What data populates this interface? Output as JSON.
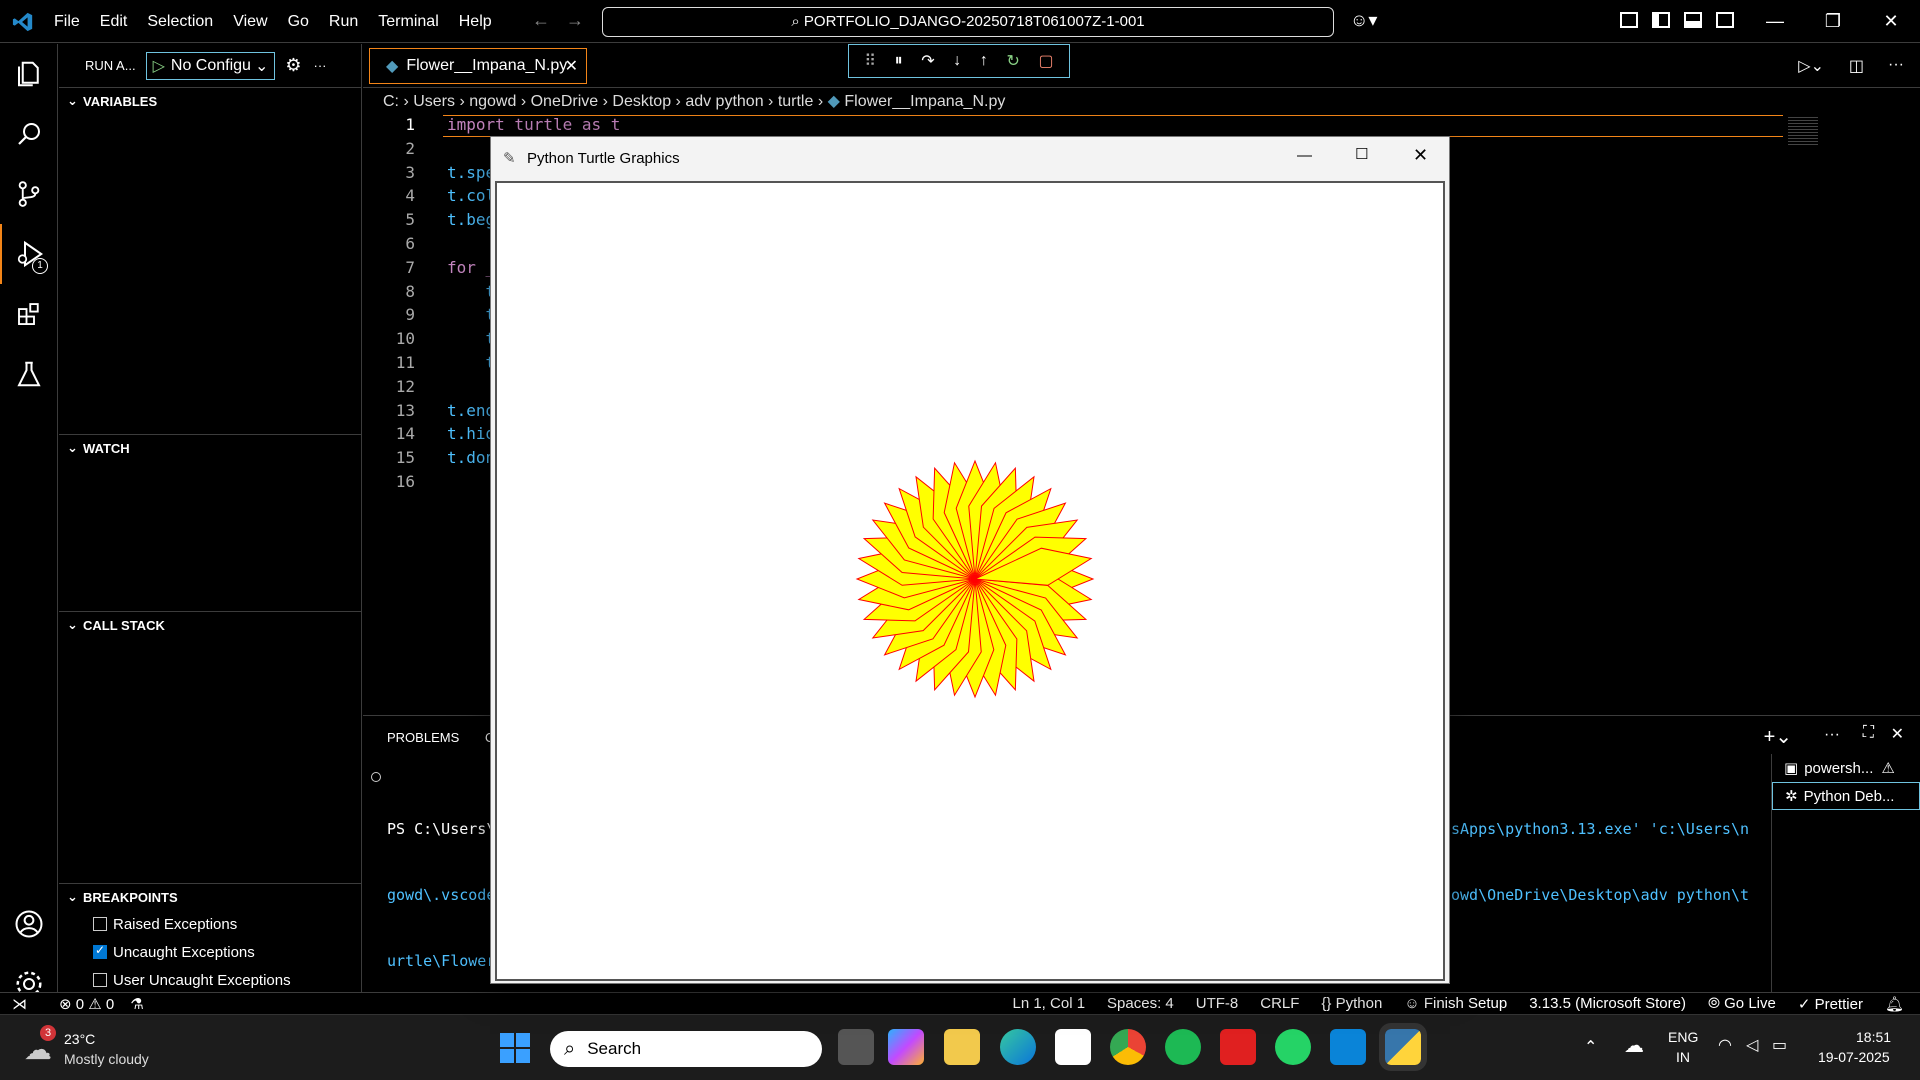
{
  "titlebar": {
    "menu": [
      "File",
      "Edit",
      "Selection",
      "View",
      "Go",
      "Run",
      "Terminal",
      "Help"
    ],
    "command_center": "PORTFOLIO_DJANGO-20250718T061007Z-1-001"
  },
  "sidebar": {
    "run_label": "RUN A...",
    "config": "No Configu",
    "sections": {
      "variables": "VARIABLES",
      "watch": "WATCH",
      "call_stack": "CALL STACK",
      "breakpoints": "BREAKPOINTS"
    },
    "breakpoints": [
      {
        "label": "Raised Exceptions",
        "checked": false
      },
      {
        "label": "Uncaught Exceptions",
        "checked": true
      },
      {
        "label": "User Uncaught Exceptions",
        "checked": false
      }
    ]
  },
  "activity": {
    "debug_badge": "1"
  },
  "editor": {
    "tab": "Flower__Impana_N.py",
    "breadcrumb": [
      "C:",
      "Users",
      "ngowd",
      "OneDrive",
      "Desktop",
      "adv python",
      "turtle",
      "Flower__Impana_N.py"
    ],
    "line_numbers": [
      "1",
      "2",
      "3",
      "4",
      "5",
      "6",
      "7",
      "8",
      "9",
      "10",
      "11",
      "12",
      "13",
      "14",
      "15",
      "16"
    ],
    "lines": [
      "import turtle as t",
      "",
      "t.spe",
      "t.col",
      "t.beg",
      "",
      "for _",
      "    t",
      "    t",
      "    t",
      "    t",
      "",
      "t.end",
      "t.hid",
      "t.don",
      ""
    ]
  },
  "panel": {
    "tab_problems": "PROBLEMS",
    "tab_partial": "O",
    "term_left": [
      "PS C:\\Users\\",
      "gowd\\.vscode",
      "urtle\\Flower"
    ],
    "term_right": [
      "sApps\\python3.13.exe' 'c:\\Users\\n",
      "owd\\OneDrive\\Desktop\\adv python\\t",
      ""
    ],
    "terminals": [
      "powersh...",
      "Python Deb..."
    ]
  },
  "status": {
    "errors": "0",
    "warnings": "0",
    "position": "Ln 1, Col 1",
    "spaces": "Spaces: 4",
    "encoding": "UTF-8",
    "eol": "CRLF",
    "language": "Python",
    "finish": "Finish Setup",
    "interpreter": "3.13.5 (Microsoft Store)",
    "golive": "Go Live",
    "prettier": "Prettier"
  },
  "turtle_window": {
    "title": "Python Turtle Graphics"
  },
  "taskbar": {
    "weather_temp": "23°C",
    "weather_desc": "Mostly cloudy",
    "weather_badge": "3",
    "search": "Search",
    "lang": "ENG",
    "region": "IN",
    "time": "18:51",
    "date": "19-07-2025"
  },
  "colors": {
    "accent": "#f38518",
    "focus": "#6fc3df",
    "petal_fill": "#ffff00",
    "petal_line": "#ff0000"
  }
}
